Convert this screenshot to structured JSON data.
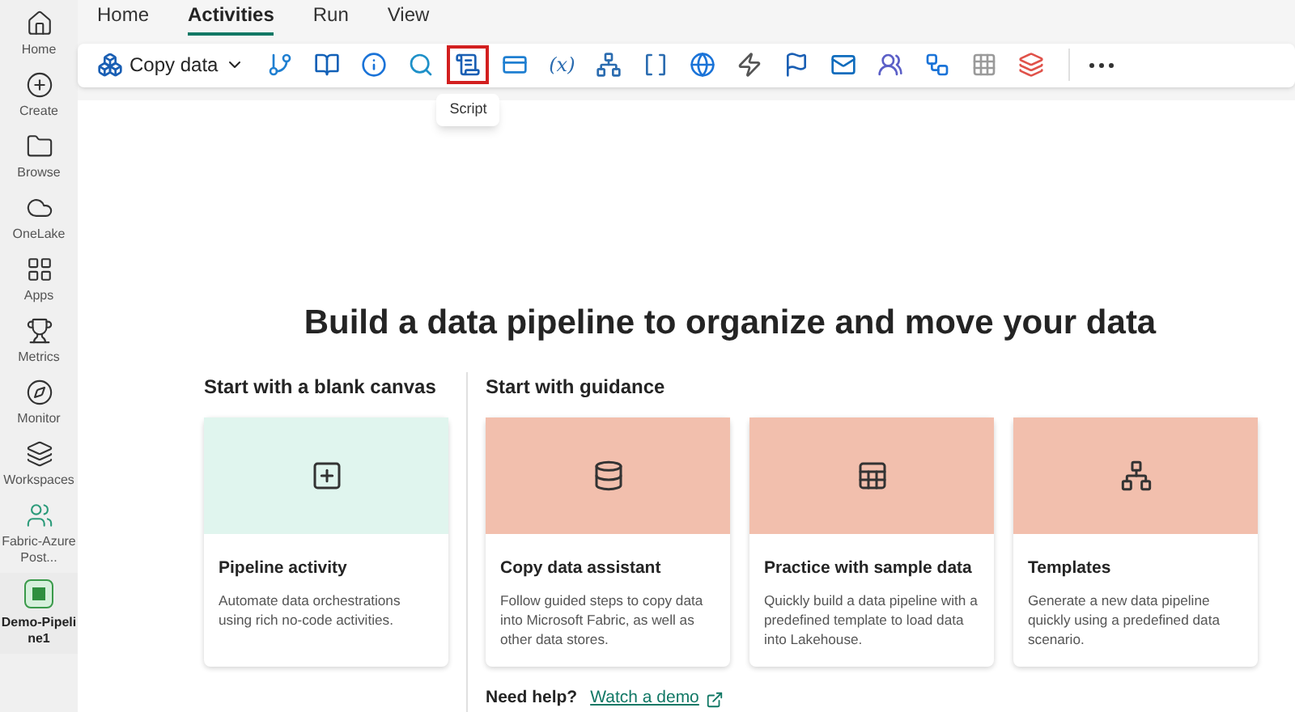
{
  "sidebar": {
    "items": [
      {
        "label": "Home",
        "kind": "home",
        "selected": false
      },
      {
        "label": "Create",
        "kind": "create",
        "selected": false
      },
      {
        "label": "Browse",
        "kind": "browse",
        "selected": false
      },
      {
        "label": "OneLake",
        "kind": "onelake",
        "selected": false
      },
      {
        "label": "Apps",
        "kind": "apps",
        "selected": false
      },
      {
        "label": "Metrics",
        "kind": "metrics",
        "selected": false
      },
      {
        "label": "Monitor",
        "kind": "monitor",
        "selected": false
      },
      {
        "label": "Workspaces",
        "kind": "workspaces",
        "selected": false
      },
      {
        "label": "Fabric-AzurePost...",
        "kind": "workspace",
        "selected": false
      },
      {
        "label": "Demo-Pipeline1",
        "kind": "pipeline",
        "selected": true
      }
    ]
  },
  "tabs": [
    {
      "label": "Home",
      "selected": false
    },
    {
      "label": "Activities",
      "selected": true
    },
    {
      "label": "Run",
      "selected": false
    },
    {
      "label": "View",
      "selected": false
    }
  ],
  "toolbar": {
    "copy_data": {
      "label": "Copy data"
    },
    "tools": [
      {
        "kind": "branch",
        "highlighted": false
      },
      {
        "kind": "notebook",
        "highlighted": false
      },
      {
        "kind": "info",
        "highlighted": false
      },
      {
        "kind": "lookup",
        "highlighted": false
      },
      {
        "kind": "script",
        "highlighted": true,
        "tooltip": "Script"
      },
      {
        "kind": "card",
        "highlighted": false
      },
      {
        "kind": "text",
        "label": "(x)",
        "highlighted": false
      },
      {
        "kind": "flow",
        "highlighted": false
      },
      {
        "kind": "bracket",
        "highlighted": false
      },
      {
        "kind": "globe",
        "highlighted": false
      },
      {
        "kind": "bolt",
        "highlighted": false
      },
      {
        "kind": "flag",
        "highlighted": false
      },
      {
        "kind": "mail",
        "highlighted": false
      },
      {
        "kind": "team",
        "highlighted": false
      },
      {
        "kind": "diagram",
        "highlighted": false
      },
      {
        "kind": "grid",
        "highlighted": false
      },
      {
        "kind": "layers",
        "highlighted": false
      }
    ]
  },
  "main": {
    "heading": "Build a data pipeline to organize and move your data",
    "sections": [
      {
        "title": "Start with a blank canvas",
        "cards": [
          {
            "kind": "pipeline",
            "color": "#e0f5ee",
            "title": "Pipeline activity",
            "description": "Automate data orchestrations using rich no-code activities."
          }
        ]
      },
      {
        "title": "Start with guidance",
        "cards": [
          {
            "kind": "copy",
            "color": "#f2bfad",
            "title": "Copy data assistant",
            "description": "Follow guided steps to copy data into Microsoft Fabric, as well as other data stores."
          },
          {
            "kind": "sample",
            "color": "#f2bfad",
            "title": "Practice with sample data",
            "description": "Quickly build a data pipeline with a predefined template to load data into Lakehouse."
          },
          {
            "kind": "templates",
            "color": "#f2bfad",
            "title": "Templates",
            "description": "Generate a new data pipeline quickly using a predefined data scenario."
          }
        ]
      }
    ],
    "help": {
      "label": "Need help?",
      "link": "Watch a demo"
    }
  }
}
